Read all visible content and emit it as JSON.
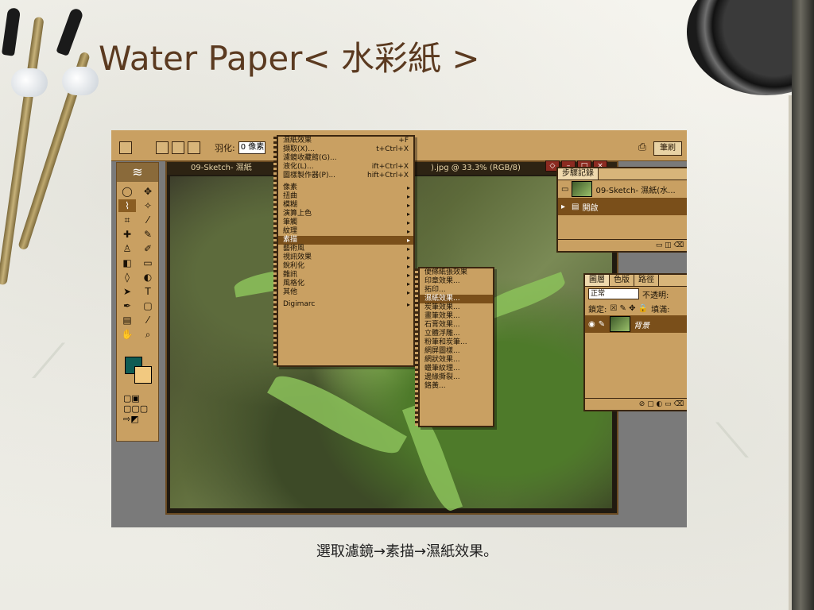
{
  "slide": {
    "title": "Water Paper< 水彩紙 >",
    "caption": "選取濾鏡→素描→濕紙效果。"
  },
  "options_bar": {
    "feather_label": "羽化:",
    "feather_value": "0 像素",
    "right_button": "筆刷"
  },
  "document": {
    "title_left": "09-Sketch- 濕紙",
    "title_right": ").jpg @ 33.3% (RGB/8)"
  },
  "filter_menu": {
    "items": [
      {
        "label": "濕紙效果",
        "shortcut": "+F"
      },
      {
        "label": "擷取(X)...",
        "shortcut": "t+Ctrl+X"
      },
      {
        "label": "濾鏡收藏館(G)...",
        "shortcut": ""
      },
      {
        "label": "液化(L)...",
        "shortcut": "ift+Ctrl+X"
      },
      {
        "label": "圖樣製作器(P)...",
        "shortcut": "hift+Ctrl+X"
      },
      {
        "label": "像素"
      },
      {
        "label": "扭曲"
      },
      {
        "label": "模糊"
      },
      {
        "label": "演算上色"
      },
      {
        "label": "筆觸"
      },
      {
        "label": "紋理"
      },
      {
        "label": "素描"
      },
      {
        "label": "藝術風"
      },
      {
        "label": "視訊效果"
      },
      {
        "label": "銳利化"
      },
      {
        "label": "雜訊"
      },
      {
        "label": "風格化"
      },
      {
        "label": "其他"
      },
      {
        "label": "Digimarc"
      }
    ]
  },
  "sketch_menu": {
    "items": [
      "便條紙張效果",
      "印章效果...",
      "拓印...",
      "濕紙效果...",
      "炭筆效果...",
      "畫筆效果...",
      "石膏效果...",
      "立體浮雕...",
      "粉筆和炭筆...",
      "網屏圖樣...",
      "網狀效果...",
      "蠟筆紋理...",
      "邊緣撕裂...",
      "鉻黃..."
    ]
  },
  "history_panel": {
    "tab": "步驟記錄",
    "snapshot": "09-Sketch- 濕紙(水...",
    "step": "開啟"
  },
  "layers_panel": {
    "tabs": [
      "圖層",
      "色版",
      "路徑"
    ],
    "blend_mode": "正常",
    "opacity_label": "不透明:",
    "lock_label": "鎖定:",
    "fill_label": "填滿:",
    "layer_name": "背景"
  },
  "colors": {
    "title": "#5b3a20",
    "ui_gold": "#c9a062",
    "highlight": "#7a4f1a",
    "foreground_swatch": "#0f5c54",
    "background_swatch": "#f2c980"
  }
}
